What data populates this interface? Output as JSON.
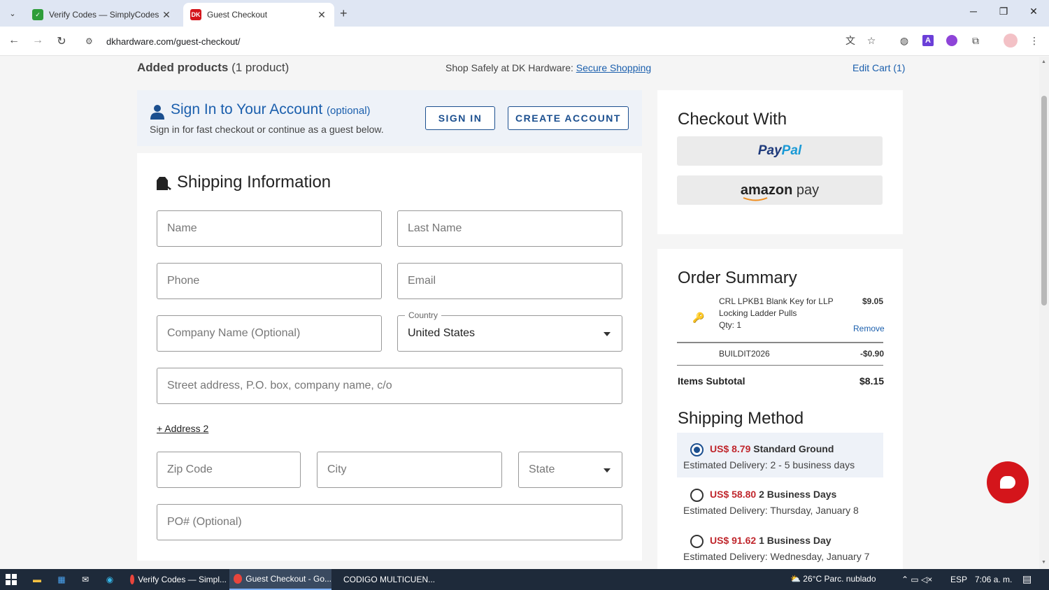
{
  "browser": {
    "tabs": [
      {
        "title": "Verify Codes — SimplyCodes",
        "favicon_color": "#2e9d3a"
      },
      {
        "title": "Guest Checkout",
        "favicon_text": "DK",
        "favicon_color": "#d4151b"
      }
    ],
    "url": "dkhardware.com/guest-checkout/"
  },
  "header": {
    "added_label": "Added products",
    "added_count": "(1 product)",
    "shop_safely": "Shop Safely at DK Hardware:",
    "secure_link": "Secure Shopping",
    "edit_cart": "Edit Cart (1)"
  },
  "signin": {
    "title": "Sign In to Your Account",
    "optional": "(optional)",
    "subtitle": "Sign in for fast checkout or continue as a guest below.",
    "sign_in_btn": "SIGN IN",
    "create_btn": "CREATE ACCOUNT"
  },
  "shipping": {
    "title": "Shipping Information",
    "name_ph": "Name",
    "last_name_ph": "Last Name",
    "phone_ph": "Phone",
    "email_ph": "Email",
    "company_ph": "Company Name (Optional)",
    "country_label": "Country",
    "country_value": "United States",
    "street_ph": "Street address, P.O. box, company name, c/o",
    "address2_link": "+ Address 2",
    "zip_ph": "Zip Code",
    "city_ph": "City",
    "state_ph": "State",
    "po_ph": "PO# (Optional)"
  },
  "checkout_with": {
    "title": "Checkout With",
    "paypal_1": "Pay",
    "paypal_2": "Pal",
    "amazon": "amazon",
    "amazon_pay": "pay"
  },
  "order_summary": {
    "title": "Order Summary",
    "item": {
      "name": "CRL LPKB1 Blank Key for LLP Locking Ladder Pulls",
      "qty": "Qty: 1",
      "price": "$9.05",
      "remove": "Remove"
    },
    "coupon_code": "BUILDIT2026",
    "coupon_value": "-$0.90",
    "subtotal_label": "Items Subtotal",
    "subtotal_value": "$8.15"
  },
  "shipping_method": {
    "title": "Shipping Method",
    "options": [
      {
        "price": "US$ 8.79",
        "name": "Standard Ground",
        "estimate": "Estimated Delivery: 2 - 5 business days",
        "selected": true
      },
      {
        "price": "US$ 58.80",
        "name": "2 Business Days",
        "estimate": "Estimated Delivery: Thursday, January 8",
        "selected": false
      },
      {
        "price": "US$ 91.62",
        "name": "1 Business Day",
        "estimate": "Estimated Delivery: Wednesday, January 7",
        "selected": false
      }
    ]
  },
  "taskbar": {
    "tasks": [
      "Verify Codes — Simpl...",
      "Guest Checkout - Go...",
      "CODIGO MULTICUEN..."
    ],
    "weather": "26°C  Parc. nublado",
    "lang": "ESP",
    "time": "7:06 a. m."
  },
  "colors": {
    "brand_blue": "#1b5fad",
    "price_red": "#c0272d",
    "chat_red": "#d4151b"
  }
}
